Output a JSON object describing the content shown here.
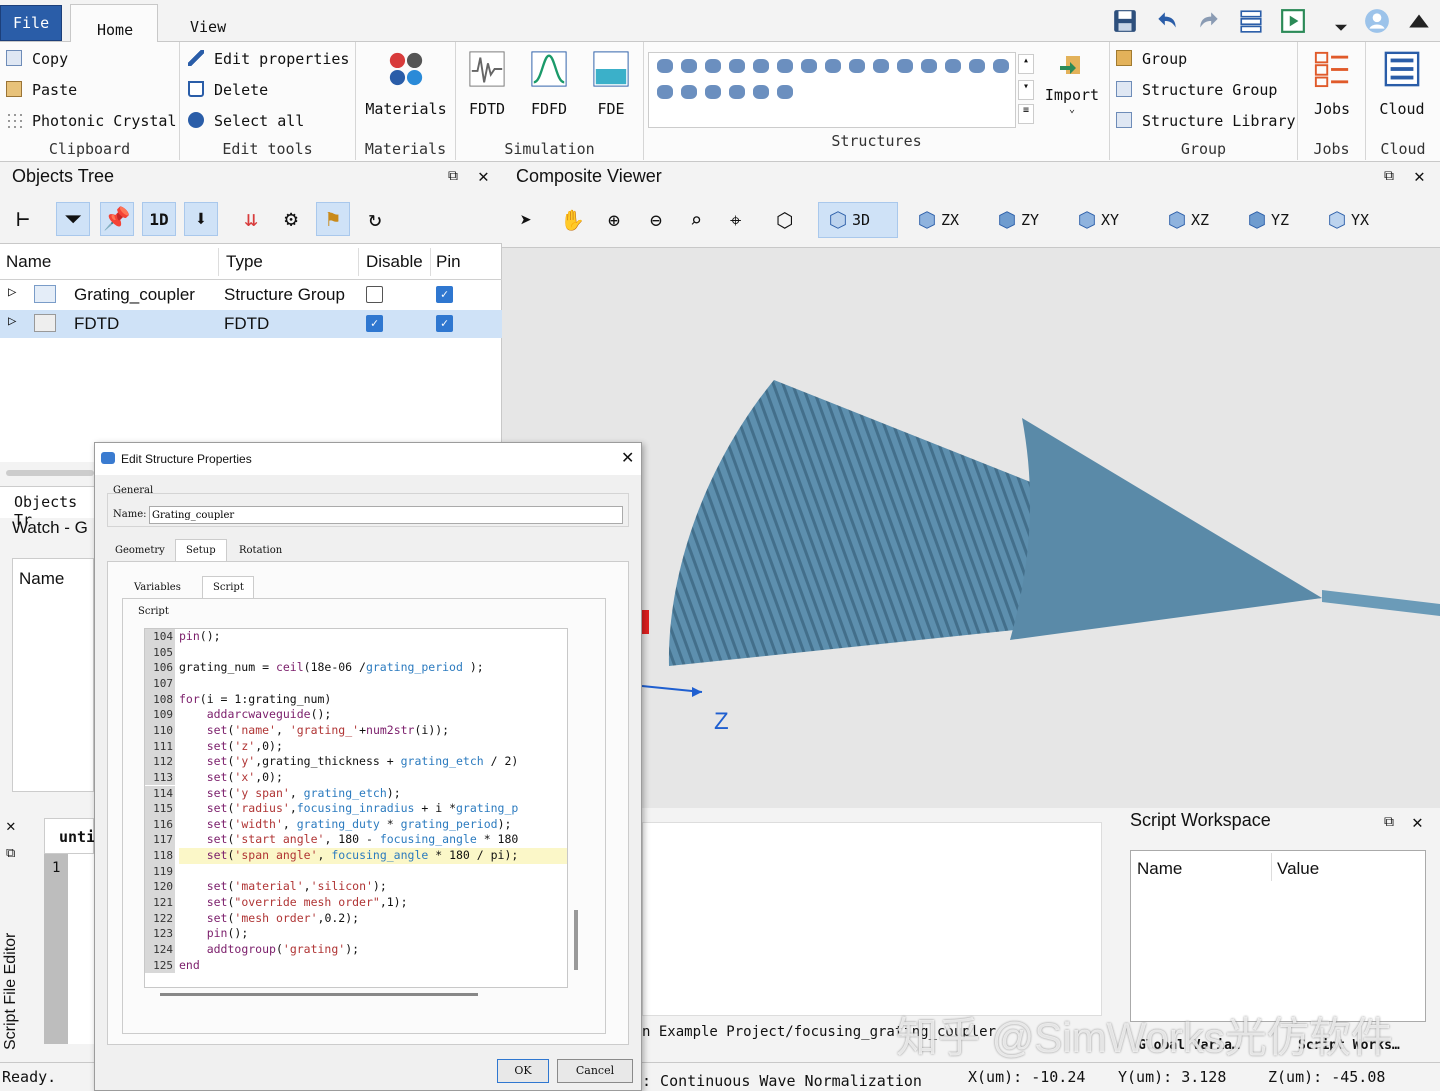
{
  "ribbon_tabs": {
    "file": "File",
    "home": "Home",
    "view": "View"
  },
  "clipboard": {
    "copy": "Copy",
    "paste": "Paste",
    "photonic": "Photonic Crystal",
    "label": "Clipboard"
  },
  "edit_tools": {
    "edit_props": "Edit properties",
    "delete": "Delete",
    "select_all": "Select all",
    "label": "Edit tools"
  },
  "materials": {
    "button": "Materials",
    "label": "Materials"
  },
  "simulation": {
    "fdtd": "FDTD",
    "fdfd": "FDFD",
    "fde": "FDE",
    "label": "Simulation"
  },
  "structures": {
    "label": "Structures",
    "import": "Import"
  },
  "group": {
    "group": "Group",
    "structure_group": "Structure Group",
    "structure_library": "Structure Library",
    "label": "Group"
  },
  "jobs": {
    "button": "Jobs",
    "label": "Jobs"
  },
  "cloud": {
    "button": "Cloud",
    "label": "Cloud"
  },
  "objects_tree": {
    "title": "Objects Tree",
    "columns": [
      "Name",
      "Type",
      "Disable",
      "Pin"
    ],
    "rows": [
      {
        "name": "Grating_coupler",
        "type": "Structure Group",
        "disable": false,
        "pin": true
      },
      {
        "name": "FDTD",
        "type": "FDTD",
        "disable": true,
        "pin": true
      }
    ],
    "tab_label": "Objects Tr",
    "watch_label": "Watch - G",
    "watch_col": "Name"
  },
  "viewer": {
    "title": "Composite Viewer",
    "views": [
      "3D",
      "ZX",
      "ZY",
      "XY",
      "XZ",
      "YZ",
      "YX"
    ],
    "axis_label": "Z"
  },
  "dialog": {
    "title": "Edit Structure Properties",
    "general": "General",
    "name_label": "Name:",
    "name_value": "Grating_coupler",
    "tabs": [
      "Geometry",
      "Setup",
      "Rotation"
    ],
    "subtabs": [
      "Variables",
      "Script"
    ],
    "script_label": "Script",
    "ok": "OK",
    "cancel": "Cancel"
  },
  "code_lines": [
    {
      "n": "104",
      "t": "pin();"
    },
    {
      "n": "105",
      "t": ""
    },
    {
      "n": "106",
      "t": "grating_num = ceil(18e-06 /grating_period );"
    },
    {
      "n": "107",
      "t": ""
    },
    {
      "n": "108",
      "t": "for(i = 1:grating_num)"
    },
    {
      "n": "109",
      "t": "    addarcwaveguide();"
    },
    {
      "n": "110",
      "t": "    set('name', 'grating_'+num2str(i));"
    },
    {
      "n": "111",
      "t": "    set('z',0);"
    },
    {
      "n": "112",
      "t": "    set('y',grating_thickness + grating_etch / 2)"
    },
    {
      "n": "113",
      "t": "    set('x',0);"
    },
    {
      "n": "114",
      "t": "    set('y span', grating_etch);"
    },
    {
      "n": "115",
      "t": "    set('radius',focusing_inradius + i *grating_p"
    },
    {
      "n": "116",
      "t": "    set('width', grating_duty * grating_period);"
    },
    {
      "n": "117",
      "t": "    set('start angle', 180 - focusing_angle * 180"
    },
    {
      "n": "118",
      "t": "    set('span angle', focusing_angle * 180 / pi);"
    },
    {
      "n": "119",
      "t": ""
    },
    {
      "n": "120",
      "t": "    set('material','silicon');"
    },
    {
      "n": "121",
      "t": "    set(\"override mesh order\",1);"
    },
    {
      "n": "122",
      "t": "    set('mesh order',0.2);"
    },
    {
      "n": "123",
      "t": "    pin();"
    },
    {
      "n": "124",
      "t": "    addtogroup('grating');"
    },
    {
      "n": "125",
      "t": "end"
    }
  ],
  "script_editor": {
    "side_label": "Script File Editor",
    "tab": "unti",
    "line": "1"
  },
  "script_workspace": {
    "title": "Script Workspace",
    "columns": [
      "Name",
      "Value"
    ],
    "tabs": [
      "Global Varia…",
      "Script Works…"
    ]
  },
  "bottom": {
    "path": "n Example Project/focusing_grating_coupler",
    "status": "Ready.",
    "normalization": ": Continuous Wave Normalization",
    "x": "X(um): -10.24",
    "y": "Y(um): 3.128",
    "z": "Z(um): -45.08"
  },
  "watermark": "知乎 @SimWorks光仿软件"
}
